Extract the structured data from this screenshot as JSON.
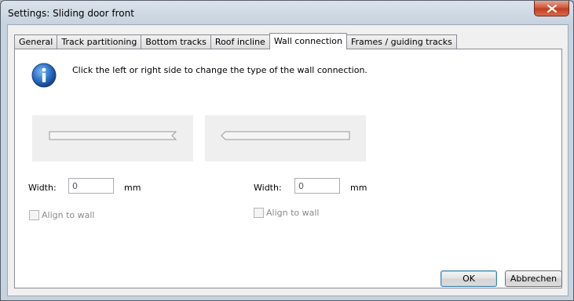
{
  "window": {
    "title": "Settings: Sliding door front"
  },
  "tabs": [
    {
      "label": "General"
    },
    {
      "label": "Track partitioning"
    },
    {
      "label": "Bottom tracks"
    },
    {
      "label": "Roof incline"
    },
    {
      "label": "Wall connection",
      "active": true
    },
    {
      "label": "Frames / guiding tracks"
    }
  ],
  "info": {
    "text": "Click the left or right side to change the type of the wall connection."
  },
  "left": {
    "width_label": "Width:",
    "width_value": "0",
    "unit": "mm",
    "align_label": "Align to wall",
    "align_checked": false
  },
  "right": {
    "width_label": "Width:",
    "width_value": "0",
    "unit": "mm",
    "align_label": "Align to wall",
    "align_checked": false
  },
  "buttons": {
    "ok": "OK",
    "cancel": "Abbrechen"
  },
  "icons": {
    "info": "info-icon",
    "close": "close-icon"
  }
}
